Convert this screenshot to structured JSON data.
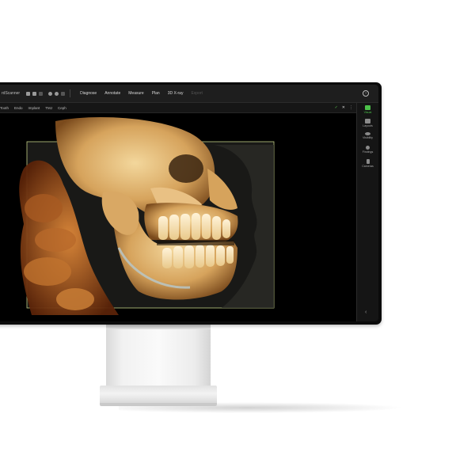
{
  "app": {
    "title_fragment": "rdScanner"
  },
  "topbar": {
    "menu": [
      "Diagnose",
      "Annotate",
      "Measure",
      "Plan",
      "3D X-ray",
      "Export"
    ],
    "menu_disabled_index": 5,
    "help_label": "?"
  },
  "subbar": {
    "tabs": [
      "Tooth",
      "Endo",
      "Implant",
      "TMJ",
      "Ceph"
    ],
    "check_glyph": "✓",
    "close_glyph": "✕",
    "more_glyph": "⋮"
  },
  "sidebar": {
    "items": [
      {
        "label": "Visual",
        "icon": "visual-icon",
        "active": true
      },
      {
        "label": "Layouts",
        "icon": "layouts-icon",
        "active": false
      },
      {
        "label": "Visibility",
        "icon": "eye-icon",
        "active": false
      },
      {
        "label": "Findings",
        "icon": "findings-icon",
        "active": false
      },
      {
        "label": "Cameras",
        "icon": "camera-icon",
        "active": false
      }
    ],
    "collapse_glyph": "‹"
  },
  "colors": {
    "accent": "#4cc14a",
    "toolbar_bg": "#1e1e1e",
    "viewport_bg": "#000000",
    "bone": "#d8ab68",
    "frame_line": "#c2cf86"
  },
  "viewport": {
    "content": "3D CBCT volume rendering of skull and jaw"
  }
}
